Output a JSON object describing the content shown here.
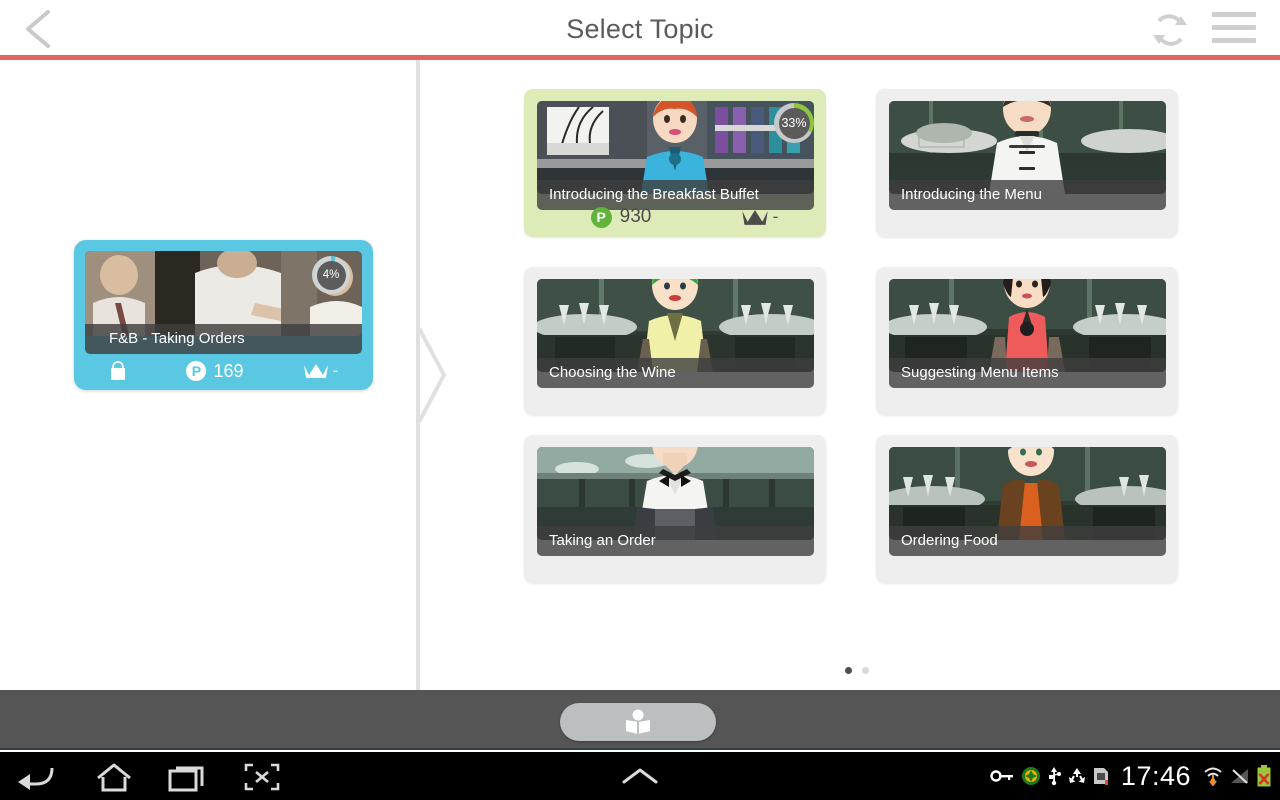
{
  "header": {
    "title": "Select Topic",
    "back_icon": "chevron-left-icon",
    "refresh_icon": "refresh-icon",
    "menu_icon": "hamburger-menu-icon",
    "accent_color": "#e2635f"
  },
  "course": {
    "title": "F&B - Taking Orders",
    "progress_label": "4%",
    "progress_value": 4,
    "bag_icon": "shopping-bag-icon",
    "points_badge": "P",
    "points_value": "169",
    "crown_icon": "crown-icon",
    "crown_value": "-",
    "card_color": "#5ac8e3"
  },
  "topics": [
    {
      "title": "Introducing the Breakfast Buffet",
      "active": true,
      "progress_label": "33%",
      "progress_value": 33,
      "points_badge": "P",
      "points_value": "930",
      "crown_icon": "crown-icon",
      "crown_value": "-",
      "card_color": "#ddebb8"
    },
    {
      "title": "Introducing the Menu",
      "active": false,
      "card_color": "#eeeeee"
    },
    {
      "title": "Choosing the Wine",
      "active": false,
      "card_color": "#eeeeee"
    },
    {
      "title": "Suggesting Menu Items",
      "active": false,
      "card_color": "#eeeeee"
    },
    {
      "title": "Taking an Order",
      "active": false,
      "card_color": "#eeeeee"
    },
    {
      "title": "Ordering Food",
      "active": false,
      "card_color": "#eeeeee"
    }
  ],
  "pager": {
    "total": 2,
    "current": 1
  },
  "bottom_bar": {
    "reader_icon": "person-reading-book-icon"
  },
  "nav_bar": {
    "back_icon": "back-arrow-icon",
    "home_icon": "home-icon",
    "recent_icon": "recent-apps-icon",
    "screenshot_icon": "screenshot-icon",
    "chevron_icon": "chevron-up-icon"
  },
  "status_bar": {
    "clock": "17:46",
    "icons": [
      "key-icon",
      "green-plus-circle-icon",
      "usb-icon",
      "recycle-icon",
      "sim-card-alert-icon",
      "wifi-icon",
      "signal-off-icon",
      "battery-error-icon"
    ]
  }
}
